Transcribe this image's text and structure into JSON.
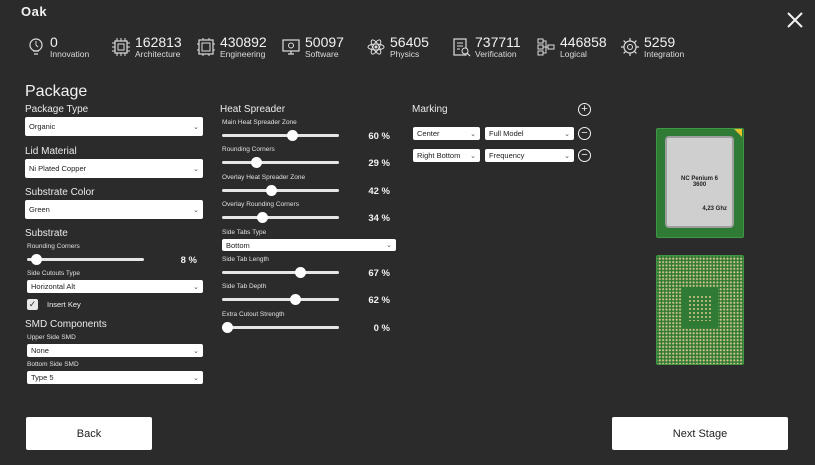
{
  "company": "Oak",
  "stats": [
    {
      "icon": "innovation-icon",
      "value": "0",
      "label": "Innovation"
    },
    {
      "icon": "architecture-icon",
      "value": "162813",
      "label": "Architecture"
    },
    {
      "icon": "engineering-icon",
      "value": "430892",
      "label": "Engineering"
    },
    {
      "icon": "software-icon",
      "value": "50097",
      "label": "Software"
    },
    {
      "icon": "physics-icon",
      "value": "56405",
      "label": "Physics"
    },
    {
      "icon": "verification-icon",
      "value": "737711",
      "label": "Verification"
    },
    {
      "icon": "logical-icon",
      "value": "446858",
      "label": "Logical"
    },
    {
      "icon": "integration-icon",
      "value": "5259",
      "label": "Integration"
    }
  ],
  "title": "Package",
  "left": {
    "package_type": {
      "label": "Package Type",
      "value": "Organic"
    },
    "lid_material": {
      "label": "Lid Material",
      "value": "Ni Plated Copper"
    },
    "substrate_color": {
      "label": "Substrate Color",
      "value": "Green"
    },
    "substrate": {
      "label": "Substrate",
      "rounding_label": "Rounding Corners",
      "rounding_value": "8 %",
      "rounding_fraction": 0.08,
      "cutouts_label": "Side Cutouts Type",
      "cutouts_value": "Horizontal Alt",
      "insert_key": "Insert Key",
      "insert_key_checked": true,
      "check_mark": "✓"
    },
    "smd": {
      "label": "SMD Components",
      "upper_label": "Upper Side SMD",
      "upper_value": "None",
      "bottom_label": "Bottom Side SMD",
      "bottom_value": "Type 5"
    }
  },
  "heat_spreader": {
    "label": "Heat Spreader",
    "main_zone": {
      "label": "Main Heat Spreader Zone",
      "value": "60 %",
      "fraction": 0.6
    },
    "rounding": {
      "label": "Rounding Corners",
      "value": "29 %",
      "fraction": 0.29
    },
    "overlay_zone": {
      "label": "Overlay Heat Spreader Zone",
      "value": "42 %",
      "fraction": 0.42
    },
    "overlay_rounding": {
      "label": "Overlay Rounding Corners",
      "value": "34 %",
      "fraction": 0.34
    },
    "side_tabs_type": {
      "label": "Side Tabs Type",
      "value": "Bottom"
    },
    "side_tab_length": {
      "label": "Side Tab Length",
      "value": "67 %",
      "fraction": 0.67
    },
    "side_tab_depth": {
      "label": "Side Tab Depth",
      "value": "62 %",
      "fraction": 0.62
    },
    "extra_cutout": {
      "label": "Extra Cutout Strength",
      "value": "0 %",
      "fraction": 0.0
    }
  },
  "marking": {
    "label": "Marking",
    "add_symbol": "+",
    "remove_symbol": "−",
    "rows": [
      {
        "position": "Center",
        "content": "Full Model"
      },
      {
        "position": "Right Bottom",
        "content": "Frequency"
      }
    ]
  },
  "chip": {
    "model_line1": "NC Penium  6",
    "model_line2": "3600",
    "frequency": "4,23 Ghz"
  },
  "chevron": "⌄",
  "buttons": {
    "back": "Back",
    "next": "Next Stage"
  },
  "colors": {
    "background": "#2b2b2b",
    "pcb": "#2f7a34",
    "heat_spreader": "#cfcfcf",
    "corner_marker": "#e7c02a"
  }
}
